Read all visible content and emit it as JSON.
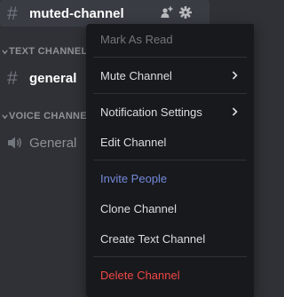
{
  "active_channel": {
    "hash": "#",
    "name": "muted-channel"
  },
  "categories": {
    "text": {
      "label": "TEXT CHANNELS"
    },
    "voice": {
      "label": "VOICE CHANNELS"
    }
  },
  "text_channel": {
    "hash": "#",
    "name": "general"
  },
  "voice_channel": {
    "name": "General"
  },
  "menu": {
    "items": [
      {
        "label": "Mark As Read",
        "state": "disabled"
      },
      {
        "label": "Mute Channel",
        "has_submenu": true
      },
      {
        "label": "Notification Settings",
        "has_submenu": true
      },
      {
        "label": "Edit Channel"
      },
      {
        "label": "Invite People",
        "color": "#7289da"
      },
      {
        "label": "Clone Channel"
      },
      {
        "label": "Create Text Channel"
      },
      {
        "label": "Delete Channel",
        "color": "#f04747"
      }
    ]
  },
  "icons": [
    "add-member-icon",
    "gear-icon",
    "chevron-down-icon",
    "speaker-icon",
    "chevron-right-icon"
  ],
  "colors": {
    "background": "#2f3136",
    "menu": "#18191c",
    "invite": "#7289da",
    "danger": "#f04747"
  }
}
